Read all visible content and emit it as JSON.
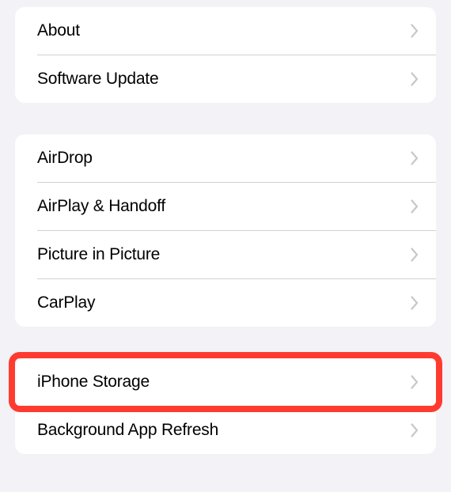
{
  "section1": {
    "items": [
      {
        "label": "About"
      },
      {
        "label": "Software Update"
      }
    ]
  },
  "section2": {
    "items": [
      {
        "label": "AirDrop"
      },
      {
        "label": "AirPlay & Handoff"
      },
      {
        "label": "Picture in Picture"
      },
      {
        "label": "CarPlay"
      }
    ]
  },
  "section3": {
    "items": [
      {
        "label": "iPhone Storage"
      },
      {
        "label": "Background App Refresh"
      }
    ]
  }
}
